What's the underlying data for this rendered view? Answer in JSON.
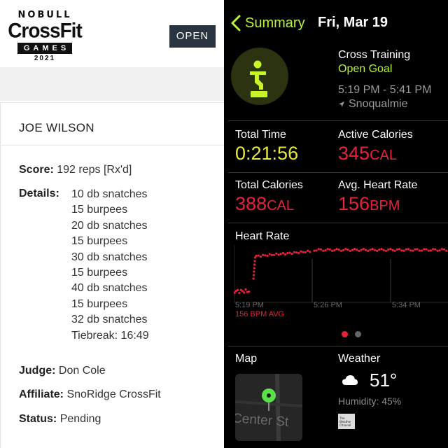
{
  "left": {
    "logo": {
      "top": "NOBULL",
      "main": "CrossFit",
      "sub": "GAMES",
      "year": "2021"
    },
    "open_button": "OPEN",
    "athlete": "JOE WILSON",
    "score_label": "Score:",
    "score_value": "192 reps [Rx'd]",
    "details_label": "Details:",
    "details": [
      "10 db snatches",
      "15 burpees",
      "20 db snatches",
      "15 burpees",
      "30 db snatches",
      "15 burpees",
      "40 db snatches",
      "15 burpees",
      "32 db snatches",
      "Tiebreak: 16:49"
    ],
    "judge_label": "Judge:",
    "judge_value": "Don Cole",
    "affiliate_label": "Affiliate:",
    "affiliate_value": "SnoRidge CrossFit",
    "status_label": "Status:",
    "status_value": "Pending"
  },
  "right": {
    "back_label": "Summary",
    "date": "Fri, Mar 19",
    "workout": {
      "type": "Cross Training",
      "goal": "Open Goal",
      "time": "5:19 PM - 5:41 PM",
      "location": "Snoqualmie"
    },
    "metrics": {
      "total_time_label": "Total Time",
      "total_time_value": "0:21:56",
      "active_cal_label": "Active Calories",
      "active_cal_value": "345",
      "active_cal_unit": "CAL",
      "total_cal_label": "Total Calories",
      "total_cal_value": "388",
      "total_cal_unit": "CAL",
      "avg_hr_label": "Avg. Heart Rate",
      "avg_hr_value": "156",
      "avg_hr_unit": "BPM"
    },
    "heart_rate": {
      "title": "Heart Rate",
      "x_ticks": [
        "5:19 PM",
        "5:26 PM",
        "5:34 PM"
      ],
      "avg_label": "156 BPM AVG"
    },
    "map": {
      "title": "Map",
      "street": "Center St"
    },
    "weather": {
      "title": "Weather",
      "temp": "51°",
      "humidity": "Humidity: 45%",
      "provider": "The Weather Channel"
    },
    "colors": {
      "accent": "#b9f536",
      "yellow": "#e6e93a",
      "red": "#e8213b"
    }
  }
}
